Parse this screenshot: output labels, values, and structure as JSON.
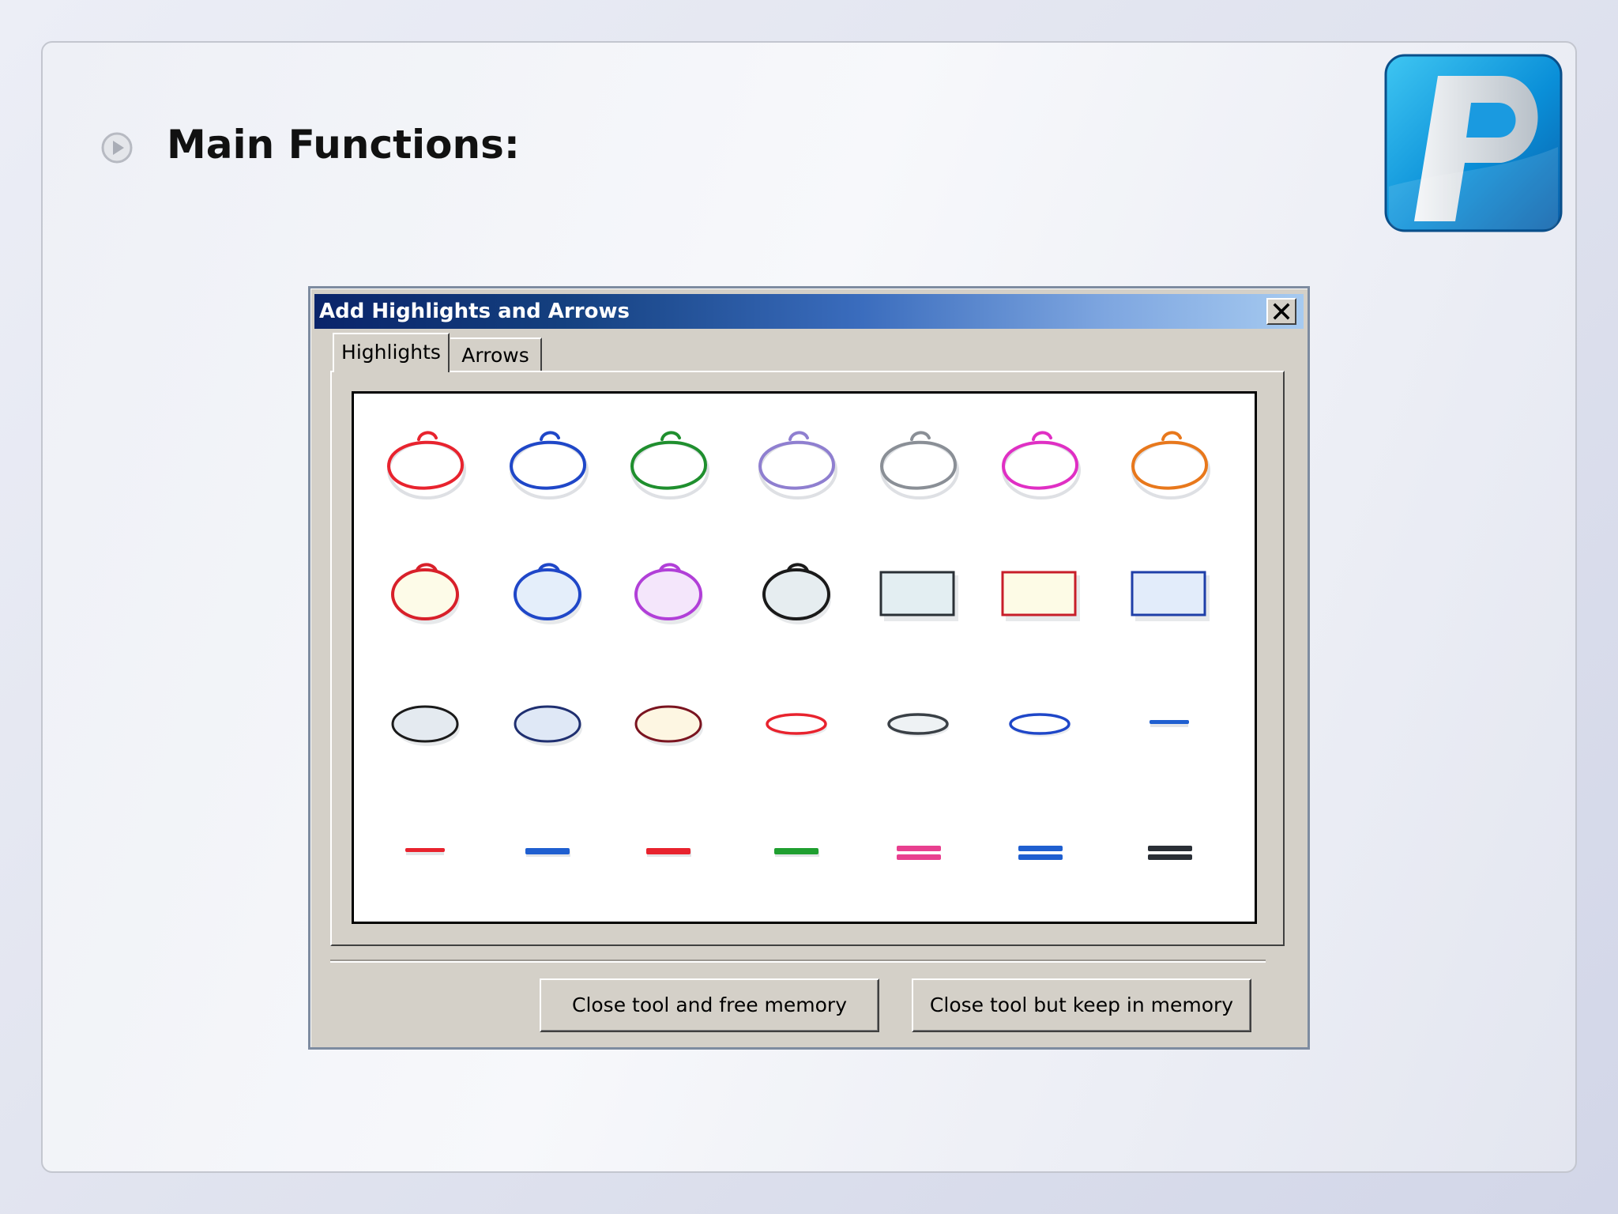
{
  "slide": {
    "heading": "Main Functions:",
    "bullet_icon": "play-circle-icon",
    "logo_icon": "p-logo-icon"
  },
  "dialog": {
    "title": "Add Highlights and Arrows",
    "close_icon": "close-icon",
    "tabs": [
      {
        "label": "Highlights",
        "selected": true
      },
      {
        "label": "Arrows",
        "selected": false
      }
    ],
    "palette": {
      "rows": [
        [
          {
            "shape": "circle-outline",
            "color": "#e8232e"
          },
          {
            "shape": "circle-outline",
            "color": "#1f47c8"
          },
          {
            "shape": "circle-outline",
            "color": "#1f8f2e"
          },
          {
            "shape": "circle-outline",
            "color": "#8f7fd0"
          },
          {
            "shape": "circle-outline",
            "color": "#8a8f96"
          },
          {
            "shape": "circle-outline",
            "color": "#e02fc4"
          },
          {
            "shape": "circle-outline",
            "color": "#e8781c"
          }
        ],
        [
          {
            "shape": "circle-filled",
            "color": "#d8202a",
            "fill": "#fdfbe8"
          },
          {
            "shape": "circle-filled",
            "color": "#1f47c8",
            "fill": "#e4eefa"
          },
          {
            "shape": "circle-filled",
            "color": "#b13fd8",
            "fill": "#f4e6fb"
          },
          {
            "shape": "circle-filled",
            "color": "#1a1a1a",
            "fill": "#e6edf0"
          },
          {
            "shape": "rect-filled",
            "color": "#2a3036",
            "fill": "#e3eef2"
          },
          {
            "shape": "rect-filled",
            "color": "#c81e2a",
            "fill": "#fdfbe6"
          },
          {
            "shape": "rect-filled",
            "color": "#1f3fa8",
            "fill": "#e2ecfa"
          }
        ],
        [
          {
            "shape": "ellipse-filled",
            "color": "#1a1a1a",
            "fill": "#e4eaf0"
          },
          {
            "shape": "ellipse-filled",
            "color": "#1f2f70",
            "fill": "#dfe8f6"
          },
          {
            "shape": "ellipse-filled",
            "color": "#7a1420",
            "fill": "#fdf6e2"
          },
          {
            "shape": "ellipse-thin",
            "color": "#e8232e",
            "fill": "#ffffff"
          },
          {
            "shape": "ellipse-thin",
            "color": "#3a4046",
            "fill": "#eef2f4"
          },
          {
            "shape": "ellipse-thin",
            "color": "#1f47c8",
            "fill": "#ffffff"
          },
          {
            "shape": "line",
            "color": "#1f5fd0"
          }
        ],
        [
          {
            "shape": "line",
            "color": "#e8232e"
          },
          {
            "shape": "line-thick",
            "color": "#1f5fd0"
          },
          {
            "shape": "line-thick",
            "color": "#e8232e"
          },
          {
            "shape": "line-thick",
            "color": "#1f9f30"
          },
          {
            "shape": "double-line",
            "color": "#e83f8f"
          },
          {
            "shape": "double-line",
            "color": "#1f5fd0"
          },
          {
            "shape": "double-line",
            "color": "#2a2f36"
          }
        ]
      ]
    },
    "buttons": {
      "free": "Close tool and free memory",
      "keep": "Close tool but keep in memory"
    }
  }
}
